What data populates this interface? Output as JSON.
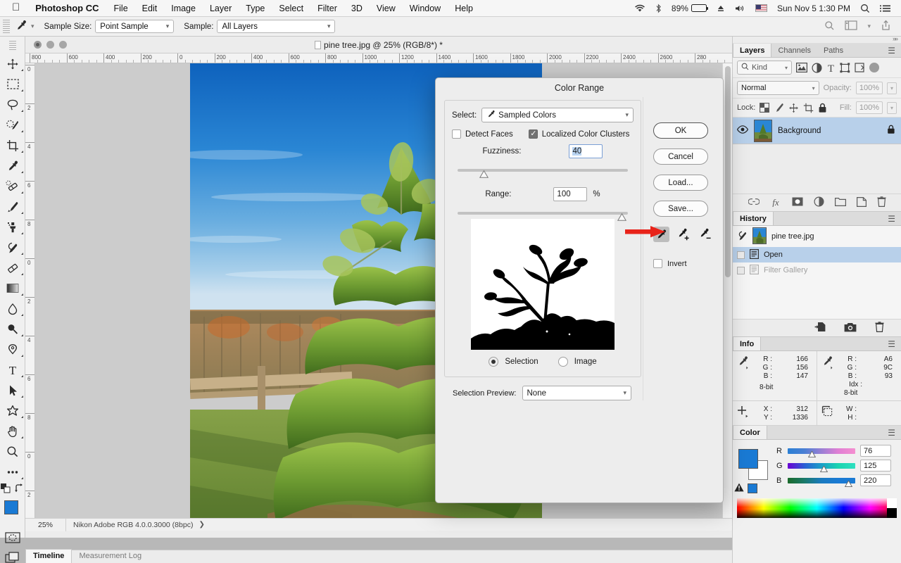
{
  "macbar": {
    "apple": "",
    "app_name": "Photoshop CC",
    "menus": [
      "File",
      "Edit",
      "Image",
      "Layer",
      "Type",
      "Select",
      "Filter",
      "3D",
      "View",
      "Window",
      "Help"
    ],
    "battery_percent": "89%",
    "datetime": "Sun Nov 5  1:30 PM",
    "icons": [
      "wifi-icon",
      "bluetooth-icon",
      "battery-icon",
      "eject-icon",
      "volume-icon",
      "us-flag-icon",
      "spotlight-search-icon",
      "notification-center-icon"
    ]
  },
  "options_bar": {
    "tool_icon": "eyedropper-icon",
    "sample_size_label": "Sample Size:",
    "sample_size_value": "Point Sample",
    "sample_label": "Sample:",
    "sample_value": "All Layers",
    "right_icons": [
      "search-icon",
      "workspace-icon",
      "chevron-down-icon",
      "share-icon"
    ]
  },
  "toolbar": {
    "tools": [
      {
        "name": "move-tool",
        "glyph": "✥"
      },
      {
        "name": "marquee-tool",
        "glyph": "⬚"
      },
      {
        "name": "lasso-tool",
        "glyph": "⟲"
      },
      {
        "name": "quick-selection-tool",
        "glyph": "✦"
      },
      {
        "name": "crop-tool",
        "glyph": "⯰"
      },
      {
        "name": "eyedropper-tool",
        "glyph": "✐"
      },
      {
        "name": "healing-brush-tool",
        "glyph": "✄"
      },
      {
        "name": "brush-tool",
        "glyph": "✎"
      },
      {
        "name": "clone-stamp-tool",
        "glyph": "⚑"
      },
      {
        "name": "history-brush-tool",
        "glyph": "❦"
      },
      {
        "name": "eraser-tool",
        "glyph": "▰"
      },
      {
        "name": "gradient-tool",
        "glyph": "▨"
      },
      {
        "name": "blur-tool",
        "glyph": "◌"
      },
      {
        "name": "dodge-tool",
        "glyph": "⚫"
      },
      {
        "name": "pen-tool",
        "glyph": "✒"
      },
      {
        "name": "type-tool",
        "glyph": "T"
      },
      {
        "name": "path-selection-tool",
        "glyph": "➤"
      },
      {
        "name": "shape-tool",
        "glyph": "⭐"
      },
      {
        "name": "hand-tool",
        "glyph": "✋"
      },
      {
        "name": "zoom-tool",
        "glyph": "⌕"
      },
      {
        "name": "more-tools",
        "glyph": "•••"
      }
    ],
    "foreground_color": "#1a7ad4",
    "background_color": "#ffffff",
    "swap_icon": "swap-colors-icon",
    "default_colors_icon": "default-colors-icon",
    "quick_mask_icon": "quick-mask-icon",
    "screen_mode_icon": "screen-mode-icon"
  },
  "document": {
    "title": "pine tree.jpg @ 25% (RGB/8*) *",
    "zoom": "25%",
    "profile": "Nikon Adobe RGB 4.0.0.3000 (8bpc)",
    "ruler_h_labels": [
      "800",
      "600",
      "400",
      "200",
      "0",
      "200",
      "400",
      "600",
      "800",
      "1000",
      "1200",
      "1400",
      "1600",
      "1800",
      "2000",
      "2200",
      "2400",
      "2600",
      "280"
    ],
    "ruler_v_labels": [
      "0",
      "2",
      "4",
      "6",
      "8",
      "0",
      "2",
      "4",
      "6",
      "8",
      "0",
      "2"
    ]
  },
  "timeline": {
    "tabs": [
      {
        "label": "Timeline",
        "active": true
      },
      {
        "label": "Measurement Log",
        "active": false
      }
    ]
  },
  "dialog": {
    "title": "Color Range",
    "select_label": "Select:",
    "select_value": "Sampled Colors",
    "select_icon": "eyedropper-icon",
    "detect_faces_label": "Detect Faces",
    "detect_faces_checked": false,
    "localized_label": "Localized Color Clusters",
    "localized_checked": true,
    "fuzziness_label": "Fuzziness:",
    "fuzziness_value": "40",
    "range_label": "Range:",
    "range_value": "100",
    "range_unit": "%",
    "invert_label": "Invert",
    "invert_checked": false,
    "preview_mode": "Selection",
    "radio_selection_label": "Selection",
    "radio_image_label": "Image",
    "selection_preview_label": "Selection Preview:",
    "selection_preview_value": "None",
    "buttons": [
      {
        "name": "ok-button",
        "label": "OK",
        "primary": true
      },
      {
        "name": "cancel-button",
        "label": "Cancel",
        "primary": false
      },
      {
        "name": "load-button",
        "label": "Load...",
        "primary": false
      },
      {
        "name": "save-button",
        "label": "Save...",
        "primary": false
      }
    ],
    "eyedroppers": [
      {
        "name": "eyedropper-sample-button",
        "active": true
      },
      {
        "name": "eyedropper-add-button",
        "active": false
      },
      {
        "name": "eyedropper-subtract-button",
        "active": false
      }
    ],
    "annotation_arrow_color": "#e8231a"
  },
  "panels": {
    "layers": {
      "tabs": [
        {
          "label": "Layers",
          "active": true
        },
        {
          "label": "Channels",
          "active": false
        },
        {
          "label": "Paths",
          "active": false
        }
      ],
      "filter_label": "Kind",
      "filter_icons": [
        "pixel-filter-icon",
        "adjustment-filter-icon",
        "type-filter-icon",
        "shape-filter-icon",
        "smartobject-filter-icon"
      ],
      "blend_mode": "Normal",
      "opacity_label": "Opacity:",
      "opacity_value": "100%",
      "lock_label": "Lock:",
      "lock_icons": [
        "lock-transparency-icon",
        "lock-image-icon",
        "lock-position-icon",
        "lock-artboard-icon",
        "lock-all-icon"
      ],
      "fill_label": "Fill:",
      "fill_value": "100%",
      "rows": [
        {
          "name": "Background",
          "visible": true,
          "locked": true
        }
      ],
      "footer_icons": [
        "link-layers-icon",
        "layer-style-fx-icon",
        "add-mask-icon",
        "adjustment-layer-icon",
        "new-group-icon",
        "new-layer-icon",
        "delete-layer-icon"
      ]
    },
    "history": {
      "tab_label": "History",
      "snapshot": "pine tree.jpg",
      "states": [
        {
          "label": "Open",
          "active": true,
          "dim": false
        },
        {
          "label": "Filter Gallery",
          "active": false,
          "dim": true
        }
      ],
      "footer_icons": [
        "new-document-from-state-icon",
        "new-snapshot-camera-icon",
        "delete-state-icon"
      ]
    },
    "info": {
      "tab_label": "Info",
      "left": {
        "icon": "eyedropper-icon",
        "rows": [
          {
            "key": "R :",
            "value": "166"
          },
          {
            "key": "G :",
            "value": "156"
          },
          {
            "key": "B :",
            "value": "147"
          }
        ],
        "depth": "8-bit"
      },
      "right": {
        "icon": "eyedropper-icon",
        "rows": [
          {
            "key": "R :",
            "value": "A6"
          },
          {
            "key": "G :",
            "value": "9C"
          },
          {
            "key": "B :",
            "value": "93"
          },
          {
            "key": "Idx :",
            "value": ""
          }
        ],
        "depth": "8-bit"
      },
      "coords": {
        "icon": "crosshair-icon",
        "rows": [
          {
            "key": "X :",
            "value": "312"
          },
          {
            "key": "Y :",
            "value": "1336"
          }
        ]
      },
      "dims": {
        "icon": "marquee-icon",
        "rows": [
          {
            "key": "W :",
            "value": ""
          },
          {
            "key": "H :",
            "value": ""
          }
        ]
      }
    },
    "color": {
      "tab_label": "Color",
      "foreground": "#1a7ad4",
      "background": "#ffffff",
      "warning_icon": "gamut-warning-icon",
      "channels": [
        {
          "label": "R",
          "value": "76",
          "gradient": "linear-gradient(to right,#2a7fd4,#4a7fd4,#9a7fd4,#e07fd4,#f58fd0)"
        },
        {
          "label": "G",
          "value": "125",
          "gradient": "linear-gradient(to right,#6a00d4,#2a5fd4,#1aa0c8,#1ad4b0,#2ee0c0)"
        },
        {
          "label": "B",
          "value": "220",
          "gradient": "linear-gradient(to right,#1a6a2a,#1a7a6a,#1a7ac0,#1a7ad4,#1a7ad4)"
        }
      ]
    }
  }
}
